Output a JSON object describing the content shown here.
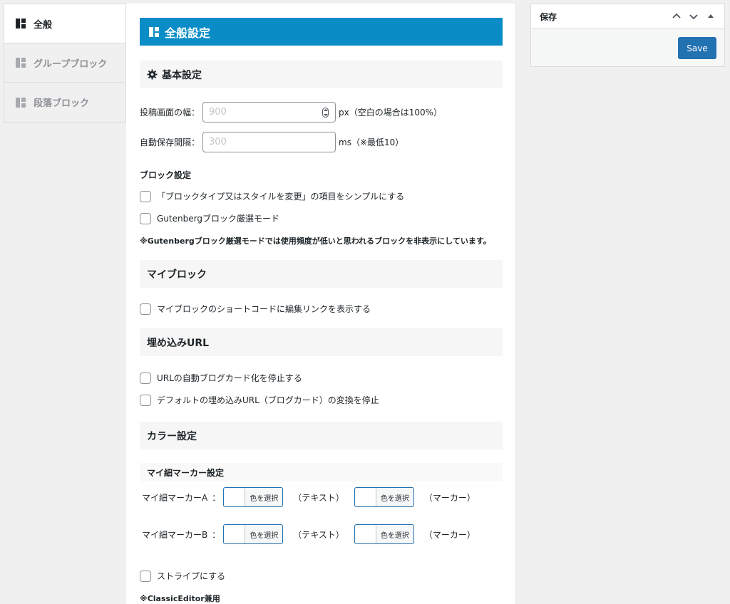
{
  "tabs": [
    {
      "label": "全般",
      "active": true
    },
    {
      "label": "グループブロック",
      "active": false
    },
    {
      "label": "段落ブロック",
      "active": false
    }
  ],
  "page_title": "全般設定",
  "basic": {
    "heading": "基本設定",
    "width_label": "投稿画面の幅：",
    "width_placeholder": "900",
    "width_unit": "px（空白の場合は100%）",
    "autosave_label": "自動保存間隔：",
    "autosave_placeholder": "300",
    "autosave_unit": "ms（※最低10）"
  },
  "block_settings": {
    "label": "ブロック設定",
    "options": [
      "「ブロックタイプ又はスタイルを変更」の項目をシンプルにする",
      "Gutenbergブロック厳選モード"
    ],
    "note": "※Gutenbergブロック厳選モードでは使用頻度が低いと思われるブロックを非表示にしています。"
  },
  "myblock": {
    "heading": "マイブロック",
    "option": "マイブロックのショートコードに編集リンクを表示する"
  },
  "embed": {
    "heading": "埋め込みURL",
    "options": [
      "URLの自動ブログカード化を停止する",
      "デフォルトの埋め込みURL（ブログカード）の変換を停止"
    ]
  },
  "color": {
    "heading": "カラー設定",
    "sub_heading": "マイ細マーカー設定",
    "rows": [
      {
        "label": "マイ細マーカーA",
        "sep": "：",
        "btn1": "色を選択",
        "text1": "（テキスト）",
        "btn2": "色を選択",
        "text2": "（マーカー）"
      },
      {
        "label": "マイ細マーカーB",
        "sep": "：",
        "btn1": "色を選択",
        "text1": "（テキスト）",
        "btn2": "色を選択",
        "text2": "（マーカー）"
      }
    ],
    "stripe_option": "ストライプにする",
    "note": "※ClassicEditor兼用"
  },
  "savebox": {
    "title": "保存",
    "button": "Save"
  },
  "colors": {
    "accent": "#0a8cc7",
    "button": "#2271b1"
  }
}
